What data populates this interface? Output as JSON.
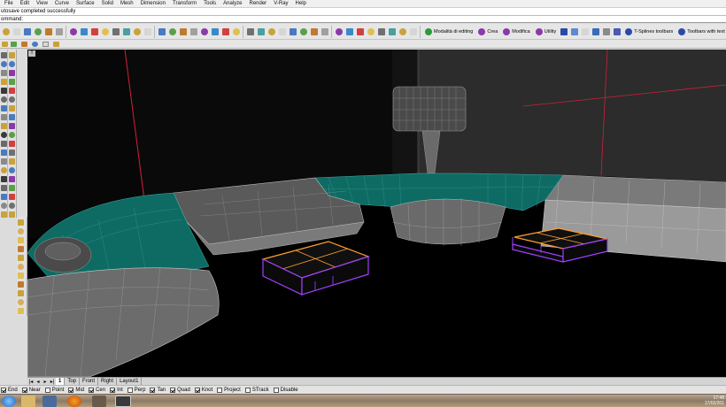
{
  "menu": [
    "File",
    "Edit",
    "View",
    "Curve",
    "Surface",
    "Solid",
    "Mesh",
    "Dimension",
    "Transform",
    "Tools",
    "Analyze",
    "Render",
    "V-Ray",
    "Help"
  ],
  "command": {
    "history": "utosave completed successfully",
    "prompt": "ommand:"
  },
  "toolbar": {
    "groups": [
      {
        "label": "Modalità di editing",
        "icon": "edit-mode-icon",
        "color": "#2a9a3a"
      },
      {
        "label": "Crea",
        "icon": "create-icon",
        "color": "#8a3aa8"
      },
      {
        "label": "Modifica",
        "icon": "modify-icon",
        "color": "#8a3aa8"
      },
      {
        "label": "Utility",
        "icon": "utility-icon",
        "color": "#8a3aa8"
      },
      {
        "label": "T-Splines toolbars",
        "icon": "tsplines-icon",
        "color": "#2a4aa8"
      },
      {
        "label": "Toolbars with text",
        "icon": "toolbars-text-icon",
        "color": "#2a4aa8"
      }
    ]
  },
  "viewport": {
    "corner_label": "T",
    "colors": {
      "background": "#000000",
      "wall_left": "#0c0c0c",
      "wall_right": "#2b2b2b",
      "teal": "#0e6b63",
      "grey": "#5a5a5a",
      "selection": "#a040ff",
      "highlight": "#ffa030",
      "axis_red": "#d0203a"
    }
  },
  "tabs": {
    "nav": [
      "|◂",
      "◂",
      "▸",
      "▸|"
    ],
    "items": [
      "1",
      "Top",
      "Front",
      "Right",
      "Layout1"
    ]
  },
  "osnap": [
    {
      "label": "End",
      "checked": true
    },
    {
      "label": "Near",
      "checked": true
    },
    {
      "label": "Point",
      "checked": false
    },
    {
      "label": "Mid",
      "checked": true
    },
    {
      "label": "Cen",
      "checked": true
    },
    {
      "label": "Int",
      "checked": true
    },
    {
      "label": "Perp",
      "checked": false
    },
    {
      "label": "Tan",
      "checked": true
    },
    {
      "label": "Quad",
      "checked": true
    },
    {
      "label": "Knot",
      "checked": true
    },
    {
      "label": "Project",
      "checked": false
    },
    {
      "label": "STrack",
      "checked": false
    },
    {
      "label": "Disable",
      "checked": false
    }
  ],
  "taskbar": {
    "time": "17:48",
    "date": "17/02/201"
  }
}
